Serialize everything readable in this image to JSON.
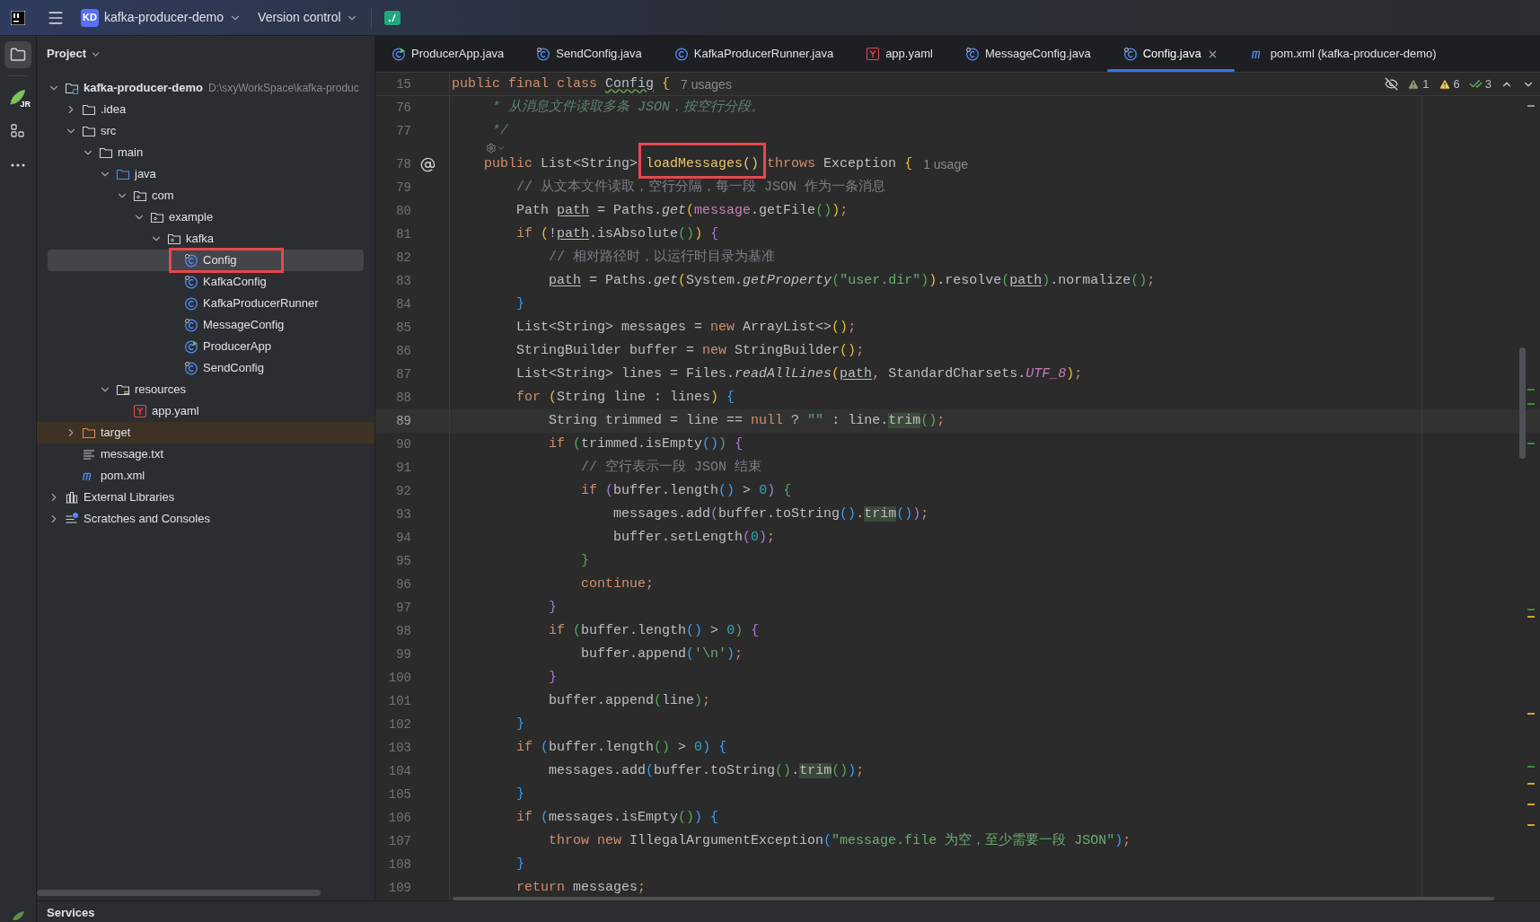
{
  "top_bar": {
    "project_badge": "KD",
    "project_name": "kafka-producer-demo",
    "vcs_label": "Version control"
  },
  "tool_strip": [
    {
      "kind": "folder",
      "selected": true
    },
    {
      "kind": "rocket",
      "badge": "JR",
      "selected": false
    },
    {
      "kind": "structure",
      "selected": false
    },
    {
      "kind": "more",
      "selected": false
    }
  ],
  "project_panel": {
    "title": "Project",
    "tree": [
      {
        "name": "kafka-producer-demo",
        "kind": "module",
        "hint": "D:\\sxyWorkSpace\\kafka-produc",
        "expanded": true,
        "selected": false,
        "children": [
          {
            "name": ".idea",
            "kind": "folder",
            "expanded": false,
            "selected": false
          },
          {
            "name": "src",
            "kind": "folder",
            "expanded": true,
            "selected": false,
            "children": [
              {
                "name": "main",
                "kind": "folder",
                "expanded": true,
                "selected": false,
                "children": [
                  {
                    "name": "java",
                    "kind": "source-folder",
                    "expanded": true,
                    "selected": false,
                    "children": [
                      {
                        "name": "com",
                        "kind": "package",
                        "expanded": true,
                        "selected": false,
                        "children": [
                          {
                            "name": "example",
                            "kind": "package",
                            "expanded": true,
                            "selected": false,
                            "children": [
                              {
                                "name": "kafka",
                                "kind": "package",
                                "expanded": true,
                                "selected": false,
                                "children": [
                                  {
                                    "name": "Config",
                                    "kind": "class-annotated",
                                    "selected": true,
                                    "annotated": true
                                  },
                                  {
                                    "name": "KafkaConfig",
                                    "kind": "class-annotated",
                                    "selected": false
                                  },
                                  {
                                    "name": "KafkaProducerRunner",
                                    "kind": "class",
                                    "selected": false
                                  },
                                  {
                                    "name": "MessageConfig",
                                    "kind": "class-annotated",
                                    "selected": false
                                  },
                                  {
                                    "name": "ProducerApp",
                                    "kind": "class-main",
                                    "selected": false
                                  },
                                  {
                                    "name": "SendConfig",
                                    "kind": "class-annotated",
                                    "selected": false
                                  }
                                ]
                              }
                            ]
                          }
                        ]
                      }
                    ]
                  },
                  {
                    "name": "resources",
                    "kind": "resources-folder",
                    "expanded": true,
                    "selected": false,
                    "children": [
                      {
                        "name": "app.yaml",
                        "kind": "yaml",
                        "selected": false
                      }
                    ]
                  }
                ]
              }
            ]
          },
          {
            "name": "target",
            "kind": "excluded-folder",
            "expanded": false,
            "selected": false
          },
          {
            "name": "message.txt",
            "kind": "text",
            "selected": false
          },
          {
            "name": "pom.xml",
            "kind": "maven",
            "selected": false
          }
        ]
      },
      {
        "name": "External Libraries",
        "kind": "libraries",
        "expanded": false,
        "selected": false
      },
      {
        "name": "Scratches and Consoles",
        "kind": "scratches",
        "expanded": false,
        "selected": false
      }
    ]
  },
  "tabs": [
    {
      "label": "ProducerApp.java",
      "kind": "class-main",
      "selected": false
    },
    {
      "label": "SendConfig.java",
      "kind": "class-annotated",
      "selected": false
    },
    {
      "label": "KafkaProducerRunner.java",
      "kind": "class",
      "selected": false
    },
    {
      "label": "app.yaml",
      "kind": "yaml",
      "selected": false
    },
    {
      "label": "MessageConfig.java",
      "kind": "class-annotated",
      "selected": false
    },
    {
      "label": "Config.java",
      "kind": "class-annotated",
      "selected": true
    },
    {
      "label": "pom.xml (kafka-producer-demo)",
      "kind": "maven",
      "selected": false
    }
  ],
  "editor": {
    "inspections": [
      {
        "kind": "weak-warning",
        "count": "1"
      },
      {
        "kind": "warning",
        "count": "6"
      },
      {
        "kind": "typo",
        "count": "3"
      }
    ],
    "sticky_line": {
      "number": "15",
      "current": false,
      "hint": "7 usages",
      "tokens": [
        {
          "kind": "keyword",
          "text": "public final class "
        },
        {
          "kind": "typo",
          "text": "Config"
        },
        {
          "kind": "brace1",
          "text": " {"
        }
      ]
    },
    "lines": [
      {
        "kind": "code",
        "number": "76",
        "current": false,
        "tokens": [
          {
            "kind": "doc",
            "text": "     * 从消息文件读取多条 JSON，按空行分段。"
          }
        ]
      },
      {
        "kind": "code",
        "number": "77",
        "current": false,
        "tokens": [
          {
            "kind": "doc",
            "text": "     */"
          }
        ]
      },
      {
        "kind": "inlay"
      },
      {
        "kind": "code",
        "number": "78",
        "current": false,
        "implements": true,
        "hint": "1 usage",
        "tokens": [
          {
            "kind": "keyword",
            "text": "    public "
          },
          {
            "kind": "plain",
            "text": "List<String> "
          },
          {
            "kind": "declaration",
            "text": "loadMessages()",
            "annotated": true
          },
          {
            "kind": "keyword",
            "text": " throws "
          },
          {
            "kind": "plain",
            "text": "Exception "
          },
          {
            "kind": "brace1",
            "text": "{"
          }
        ]
      },
      {
        "kind": "code",
        "number": "79",
        "current": false,
        "tokens": [
          {
            "kind": "comment",
            "text": "        // 从文本文件读取，空行分隔，每一段 JSON 作为一条消息"
          }
        ]
      },
      {
        "kind": "code",
        "number": "80",
        "current": false,
        "tokens": [
          {
            "kind": "plain",
            "text": "        Path "
          },
          {
            "kind": "reassigned",
            "text": "path"
          },
          {
            "kind": "plain",
            "text": " = Paths."
          },
          {
            "kind": "static",
            "text": "get"
          },
          {
            "kind": "brace1",
            "text": "("
          },
          {
            "kind": "field",
            "text": "message"
          },
          {
            "kind": "plain",
            "text": ".getFile"
          },
          {
            "kind": "brace2",
            "text": "()"
          },
          {
            "kind": "brace1",
            "text": ")"
          },
          {
            "kind": "keyword",
            "text": ";"
          }
        ]
      },
      {
        "kind": "code",
        "number": "81",
        "current": false,
        "tokens": [
          {
            "kind": "keyword",
            "text": "        if "
          },
          {
            "kind": "brace1",
            "text": "("
          },
          {
            "kind": "plain",
            "text": "!"
          },
          {
            "kind": "reassigned",
            "text": "path"
          },
          {
            "kind": "plain",
            "text": ".isAbsolute"
          },
          {
            "kind": "brace2",
            "text": "()"
          },
          {
            "kind": "brace1",
            "text": ")"
          },
          {
            "kind": "brace4",
            "text": " {"
          }
        ]
      },
      {
        "kind": "code",
        "number": "82",
        "current": false,
        "tokens": [
          {
            "kind": "comment",
            "text": "            // 相对路径时，以运行时目录为基准"
          }
        ]
      },
      {
        "kind": "code",
        "number": "83",
        "current": false,
        "tokens": [
          {
            "kind": "reassigned",
            "text": "            path"
          },
          {
            "kind": "plain",
            "text": " = Paths."
          },
          {
            "kind": "static",
            "text": "get"
          },
          {
            "kind": "brace1",
            "text": "("
          },
          {
            "kind": "plain",
            "text": "System."
          },
          {
            "kind": "static",
            "text": "getProperty"
          },
          {
            "kind": "brace2",
            "text": "("
          },
          {
            "kind": "string",
            "text": "\"user.dir\""
          },
          {
            "kind": "brace2",
            "text": ")"
          },
          {
            "kind": "brace1",
            "text": ")"
          },
          {
            "kind": "plain",
            "text": ".resolve"
          },
          {
            "kind": "brace2",
            "text": "("
          },
          {
            "kind": "reassigned",
            "text": "path"
          },
          {
            "kind": "brace2",
            "text": ")"
          },
          {
            "kind": "plain",
            "text": ".normalize"
          },
          {
            "kind": "brace2",
            "text": "()"
          },
          {
            "kind": "keyword",
            "text": ";"
          }
        ]
      },
      {
        "kind": "code",
        "number": "84",
        "current": false,
        "tokens": [
          {
            "kind": "brace3",
            "text": "        }"
          }
        ]
      },
      {
        "kind": "code",
        "number": "85",
        "current": false,
        "tokens": [
          {
            "kind": "plain",
            "text": "        List<String> messages = "
          },
          {
            "kind": "keyword",
            "text": "new "
          },
          {
            "kind": "plain",
            "text": "ArrayList<>"
          },
          {
            "kind": "brace1",
            "text": "()"
          },
          {
            "kind": "keyword",
            "text": ";"
          }
        ]
      },
      {
        "kind": "code",
        "number": "86",
        "current": false,
        "tokens": [
          {
            "kind": "plain",
            "text": "        StringBuilder buffer = "
          },
          {
            "kind": "keyword",
            "text": "new "
          },
          {
            "kind": "plain",
            "text": "StringBuilder"
          },
          {
            "kind": "brace1",
            "text": "()"
          },
          {
            "kind": "keyword",
            "text": ";"
          }
        ]
      },
      {
        "kind": "code",
        "number": "87",
        "current": false,
        "tokens": [
          {
            "kind": "plain",
            "text": "        List<String> lines = Files."
          },
          {
            "kind": "static",
            "text": "readAllLines"
          },
          {
            "kind": "brace1",
            "text": "("
          },
          {
            "kind": "reassigned",
            "text": "path"
          },
          {
            "kind": "keyword",
            "text": ", "
          },
          {
            "kind": "plain",
            "text": "StandardCharsets."
          },
          {
            "kind": "constant",
            "text": "UTF_8"
          },
          {
            "kind": "brace1",
            "text": ")"
          },
          {
            "kind": "keyword",
            "text": ";"
          }
        ]
      },
      {
        "kind": "code",
        "number": "88",
        "current": false,
        "tokens": [
          {
            "kind": "keyword",
            "text": "        for "
          },
          {
            "kind": "brace1",
            "text": "("
          },
          {
            "kind": "plain",
            "text": "String line : lines"
          },
          {
            "kind": "brace1",
            "text": ")"
          },
          {
            "kind": "brace3",
            "text": " {"
          }
        ]
      },
      {
        "kind": "code",
        "number": "89",
        "current": true,
        "tokens": [
          {
            "kind": "plain",
            "text": "            String trimmed = line == "
          },
          {
            "kind": "keyword",
            "text": "null"
          },
          {
            "kind": "plain",
            "text": " ? "
          },
          {
            "kind": "string",
            "text": "\"\""
          },
          {
            "kind": "plain",
            "text": " : line."
          },
          {
            "kind": "usage",
            "text": "trim"
          },
          {
            "kind": "brace2",
            "text": "()"
          },
          {
            "kind": "keyword",
            "text": ";"
          }
        ]
      },
      {
        "kind": "code",
        "number": "90",
        "current": false,
        "tokens": [
          {
            "kind": "keyword",
            "text": "            if "
          },
          {
            "kind": "brace2",
            "text": "("
          },
          {
            "kind": "plain",
            "text": "trimmed.isEmpty"
          },
          {
            "kind": "brace3",
            "text": "()"
          },
          {
            "kind": "brace2",
            "text": ")"
          },
          {
            "kind": "brace4",
            "text": " {"
          }
        ]
      },
      {
        "kind": "code",
        "number": "91",
        "current": false,
        "tokens": [
          {
            "kind": "comment",
            "text": "                // 空行表示一段 JSON 结束"
          }
        ]
      },
      {
        "kind": "code",
        "number": "92",
        "current": false,
        "tokens": [
          {
            "kind": "keyword",
            "text": "                if "
          },
          {
            "kind": "brace4",
            "text": "("
          },
          {
            "kind": "plain",
            "text": "buffer.length"
          },
          {
            "kind": "brace3",
            "text": "()"
          },
          {
            "kind": "plain",
            "text": " > "
          },
          {
            "kind": "number",
            "text": "0"
          },
          {
            "kind": "brace4",
            "text": ")"
          },
          {
            "kind": "brace2",
            "text": " {"
          }
        ]
      },
      {
        "kind": "code",
        "number": "93",
        "current": false,
        "tokens": [
          {
            "kind": "plain",
            "text": "                    messages.add"
          },
          {
            "kind": "brace4",
            "text": "("
          },
          {
            "kind": "plain",
            "text": "buffer.toString"
          },
          {
            "kind": "brace3",
            "text": "()"
          },
          {
            "kind": "plain",
            "text": "."
          },
          {
            "kind": "usage",
            "text": "trim"
          },
          {
            "kind": "brace3",
            "text": "()"
          },
          {
            "kind": "brace4",
            "text": ")"
          },
          {
            "kind": "keyword",
            "text": ";"
          }
        ]
      },
      {
        "kind": "code",
        "number": "94",
        "current": false,
        "tokens": [
          {
            "kind": "plain",
            "text": "                    buffer.setLength"
          },
          {
            "kind": "brace4",
            "text": "("
          },
          {
            "kind": "number",
            "text": "0"
          },
          {
            "kind": "brace4",
            "text": ")"
          },
          {
            "kind": "keyword",
            "text": ";"
          }
        ]
      },
      {
        "kind": "code",
        "number": "95",
        "current": false,
        "tokens": [
          {
            "kind": "brace2",
            "text": "                }"
          }
        ]
      },
      {
        "kind": "code",
        "number": "96",
        "current": false,
        "tokens": [
          {
            "kind": "keyword",
            "text": "                continue;"
          }
        ]
      },
      {
        "kind": "code",
        "number": "97",
        "current": false,
        "tokens": [
          {
            "kind": "brace4",
            "text": "            }"
          }
        ]
      },
      {
        "kind": "code",
        "number": "98",
        "current": false,
        "tokens": [
          {
            "kind": "keyword",
            "text": "            if "
          },
          {
            "kind": "brace2",
            "text": "("
          },
          {
            "kind": "plain",
            "text": "buffer.length"
          },
          {
            "kind": "brace3",
            "text": "()"
          },
          {
            "kind": "plain",
            "text": " > "
          },
          {
            "kind": "number",
            "text": "0"
          },
          {
            "kind": "brace2",
            "text": ")"
          },
          {
            "kind": "brace4",
            "text": " {"
          }
        ]
      },
      {
        "kind": "code",
        "number": "99",
        "current": false,
        "tokens": [
          {
            "kind": "plain",
            "text": "                buffer.append"
          },
          {
            "kind": "brace3",
            "text": "("
          },
          {
            "kind": "string",
            "text": "'\\n'"
          },
          {
            "kind": "brace3",
            "text": ")"
          },
          {
            "kind": "keyword",
            "text": ";"
          }
        ]
      },
      {
        "kind": "code",
        "number": "100",
        "current": false,
        "tokens": [
          {
            "kind": "brace4",
            "text": "            }"
          }
        ]
      },
      {
        "kind": "code",
        "number": "101",
        "current": false,
        "tokens": [
          {
            "kind": "plain",
            "text": "            buffer.append"
          },
          {
            "kind": "brace2",
            "text": "("
          },
          {
            "kind": "plain",
            "text": "line"
          },
          {
            "kind": "brace2",
            "text": ")"
          },
          {
            "kind": "keyword",
            "text": ";"
          }
        ]
      },
      {
        "kind": "code",
        "number": "102",
        "current": false,
        "tokens": [
          {
            "kind": "brace3",
            "text": "        }"
          }
        ]
      },
      {
        "kind": "code",
        "number": "103",
        "current": false,
        "tokens": [
          {
            "kind": "keyword",
            "text": "        if "
          },
          {
            "kind": "brace3",
            "text": "("
          },
          {
            "kind": "plain",
            "text": "buffer.length"
          },
          {
            "kind": "brace2",
            "text": "()"
          },
          {
            "kind": "plain",
            "text": " > "
          },
          {
            "kind": "number",
            "text": "0"
          },
          {
            "kind": "brace3",
            "text": ")"
          },
          {
            "kind": "brace3",
            "text": " {"
          }
        ]
      },
      {
        "kind": "code",
        "number": "104",
        "current": false,
        "tokens": [
          {
            "kind": "plain",
            "text": "            messages.add"
          },
          {
            "kind": "brace3",
            "text": "("
          },
          {
            "kind": "plain",
            "text": "buffer.toString"
          },
          {
            "kind": "brace2",
            "text": "()"
          },
          {
            "kind": "plain",
            "text": "."
          },
          {
            "kind": "usage",
            "text": "trim"
          },
          {
            "kind": "brace2",
            "text": "()"
          },
          {
            "kind": "brace3",
            "text": ")"
          },
          {
            "kind": "keyword",
            "text": ";"
          }
        ]
      },
      {
        "kind": "code",
        "number": "105",
        "current": false,
        "tokens": [
          {
            "kind": "brace3",
            "text": "        }"
          }
        ]
      },
      {
        "kind": "code",
        "number": "106",
        "current": false,
        "tokens": [
          {
            "kind": "keyword",
            "text": "        if "
          },
          {
            "kind": "brace3",
            "text": "("
          },
          {
            "kind": "plain",
            "text": "messages.isEmpty"
          },
          {
            "kind": "brace2",
            "text": "()"
          },
          {
            "kind": "brace3",
            "text": ")"
          },
          {
            "kind": "brace3",
            "text": " {"
          }
        ]
      },
      {
        "kind": "code",
        "number": "107",
        "current": false,
        "tokens": [
          {
            "kind": "keyword",
            "text": "            throw new "
          },
          {
            "kind": "plain",
            "text": "IllegalArgumentException"
          },
          {
            "kind": "brace3",
            "text": "("
          },
          {
            "kind": "string",
            "text": "\"message.file 为空，至少需要一段 JSON\""
          },
          {
            "kind": "brace3",
            "text": ")"
          },
          {
            "kind": "keyword",
            "text": ";"
          }
        ]
      },
      {
        "kind": "code",
        "number": "108",
        "current": false,
        "tokens": [
          {
            "kind": "brace3",
            "text": "        }"
          }
        ]
      },
      {
        "kind": "code",
        "number": "109",
        "current": false,
        "tokens": [
          {
            "kind": "keyword",
            "text": "        return "
          },
          {
            "kind": "plain",
            "text": "messages"
          },
          {
            "kind": "keyword",
            "text": ";"
          }
        ]
      }
    ]
  },
  "bottom_bar": {
    "label": "Services"
  }
}
